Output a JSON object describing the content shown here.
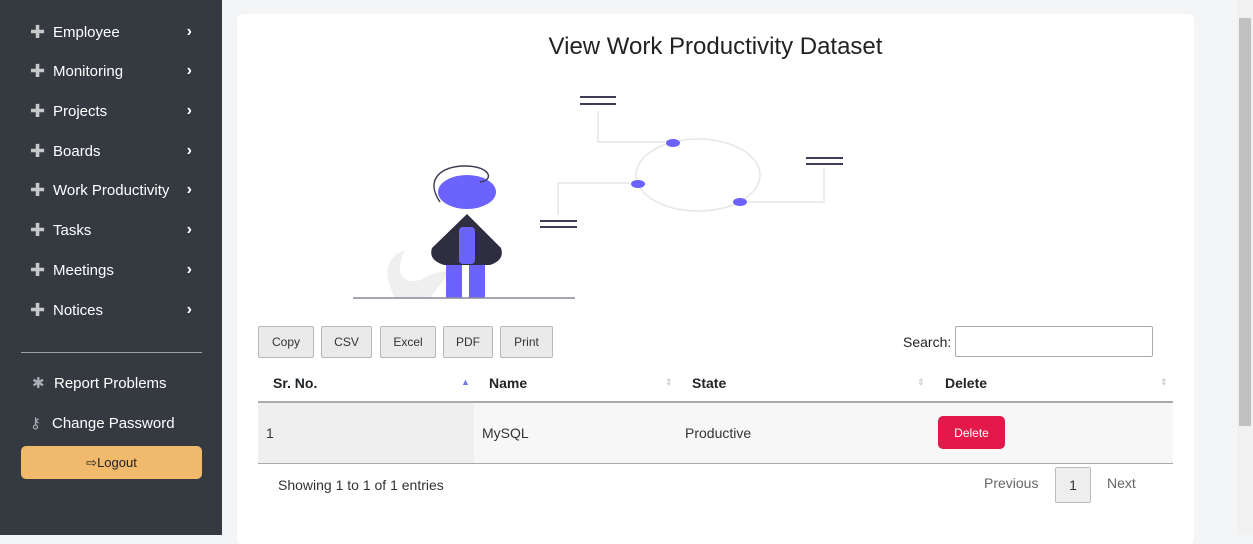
{
  "sidebar": {
    "items": [
      {
        "label": "Employee"
      },
      {
        "label": "Monitoring"
      },
      {
        "label": "Projects"
      },
      {
        "label": "Boards"
      },
      {
        "label": "Work Productivity"
      },
      {
        "label": "Tasks"
      },
      {
        "label": "Meetings"
      },
      {
        "label": "Notices"
      }
    ],
    "report": "Report Problems",
    "password": "Change Password",
    "logout": "Logout"
  },
  "main": {
    "title": "View Work Productivity Dataset",
    "buttons": [
      "Copy",
      "CSV",
      "Excel",
      "PDF",
      "Print"
    ],
    "search_label": "Search:",
    "search_value": "",
    "columns": [
      "Sr. No.",
      "Name",
      "State",
      "Delete"
    ],
    "rows": [
      {
        "sr": "1",
        "name": "MySQL",
        "state": "Productive",
        "action": "Delete"
      }
    ],
    "info": "Showing 1 to 1 of 1 entries",
    "pagination": {
      "previous": "Previous",
      "current": "1",
      "next": "Next"
    }
  },
  "colors": {
    "accent": "#6c63ff",
    "delete": "#e4194b",
    "logout": "#f0b96b",
    "sidebar": "#343a40"
  }
}
